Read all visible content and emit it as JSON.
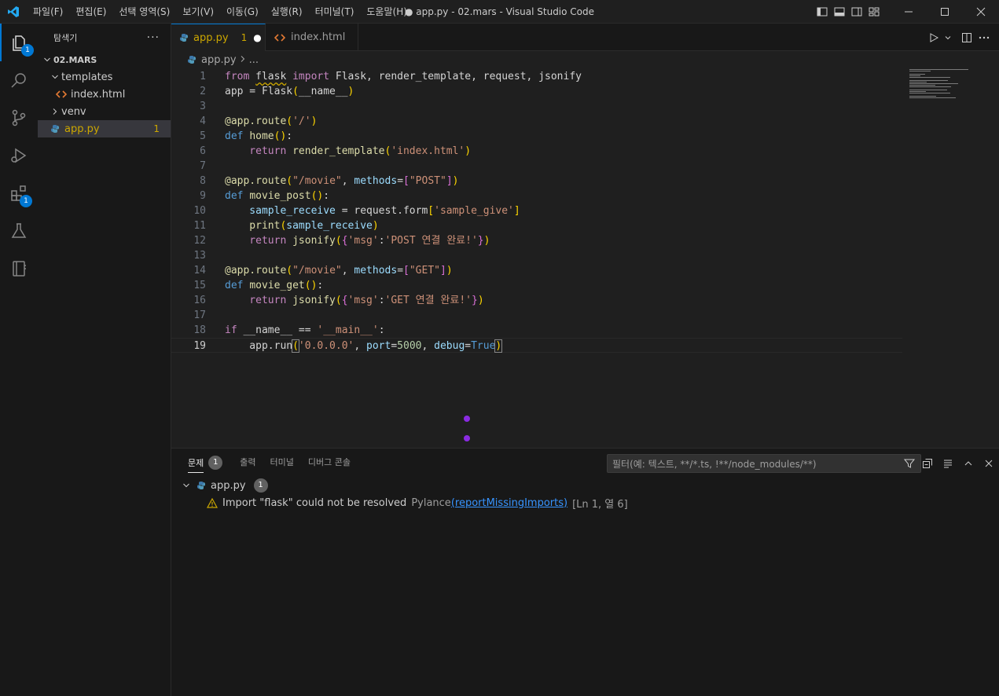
{
  "window": {
    "title": "● app.py - 02.mars - Visual Studio Code",
    "menu": [
      "파일(F)",
      "편집(E)",
      "선택 영역(S)",
      "보기(V)",
      "이동(G)",
      "실행(R)",
      "터미널(T)",
      "도움말(H)"
    ]
  },
  "activity_bar": {
    "explorer_badge": "1",
    "extensions_badge": "1"
  },
  "sidebar": {
    "title": "탐색기",
    "more": "···",
    "root": "02.MARS",
    "items": [
      {
        "label": "templates",
        "kind": "folder-open"
      },
      {
        "label": "index.html",
        "kind": "html-file"
      },
      {
        "label": "venv",
        "kind": "folder-closed"
      },
      {
        "label": "app.py",
        "kind": "python-file",
        "count": "1"
      }
    ]
  },
  "tabs": [
    {
      "label": "app.py",
      "count": "1",
      "modified": "●"
    },
    {
      "label": "index.html"
    }
  ],
  "breadcrumb": {
    "file": "app.py",
    "rest": "..."
  },
  "editor": {
    "lines": [
      {
        "n": "1",
        "tokens": [
          [
            "kw2",
            "from "
          ],
          [
            "tx sq",
            "flask"
          ],
          [
            "kw2",
            " import "
          ],
          [
            "tx",
            "Flask, render_template, request, jsonify"
          ]
        ]
      },
      {
        "n": "2",
        "tokens": [
          [
            "tx",
            "app = Flask"
          ],
          [
            "b1",
            "("
          ],
          [
            "tx",
            "__name__"
          ],
          [
            "b1",
            ")"
          ]
        ]
      },
      {
        "n": "3",
        "tokens": []
      },
      {
        "n": "4",
        "tokens": [
          [
            "fn",
            "@app.route"
          ],
          [
            "b1",
            "("
          ],
          [
            "st",
            "'/'"
          ],
          [
            "b1",
            ")"
          ]
        ]
      },
      {
        "n": "5",
        "tokens": [
          [
            "kw",
            "def "
          ],
          [
            "fn",
            "home"
          ],
          [
            "b1",
            "()"
          ],
          [
            "tx",
            ":"
          ]
        ]
      },
      {
        "n": "6",
        "tokens": [
          [
            "kw2",
            "    return "
          ],
          [
            "fn",
            "render_template"
          ],
          [
            "b1",
            "("
          ],
          [
            "st",
            "'index.html'"
          ],
          [
            "b1",
            ")"
          ]
        ]
      },
      {
        "n": "7",
        "tokens": []
      },
      {
        "n": "8",
        "tokens": [
          [
            "fn",
            "@app.route"
          ],
          [
            "b1",
            "("
          ],
          [
            "st",
            "\"/movie\""
          ],
          [
            "tx",
            ", "
          ],
          [
            "pm",
            "methods"
          ],
          [
            "tx",
            "="
          ],
          [
            "b2",
            "["
          ],
          [
            "st",
            "\"POST\""
          ],
          [
            "b2",
            "]"
          ],
          [
            "b1",
            ")"
          ]
        ]
      },
      {
        "n": "9",
        "tokens": [
          [
            "kw",
            "def "
          ],
          [
            "fn",
            "movie_post"
          ],
          [
            "b1",
            "()"
          ],
          [
            "tx",
            ":"
          ]
        ]
      },
      {
        "n": "10",
        "tokens": [
          [
            "pm",
            "    sample_receive"
          ],
          [
            "tx",
            " = request.form"
          ],
          [
            "b1",
            "["
          ],
          [
            "st",
            "'sample_give'"
          ],
          [
            "b1",
            "]"
          ]
        ]
      },
      {
        "n": "11",
        "tokens": [
          [
            "fn",
            "    print"
          ],
          [
            "b1",
            "("
          ],
          [
            "pm",
            "sample_receive"
          ],
          [
            "b1",
            ")"
          ]
        ]
      },
      {
        "n": "12",
        "tokens": [
          [
            "kw2",
            "    return "
          ],
          [
            "fn",
            "jsonify"
          ],
          [
            "b1",
            "("
          ],
          [
            "b2",
            "{"
          ],
          [
            "st",
            "'msg'"
          ],
          [
            "tx",
            ":"
          ],
          [
            "st",
            "'POST 연결 완료!'"
          ],
          [
            "b2",
            "}"
          ],
          [
            "b1",
            ")"
          ]
        ]
      },
      {
        "n": "13",
        "tokens": []
      },
      {
        "n": "14",
        "tokens": [
          [
            "fn",
            "@app.route"
          ],
          [
            "b1",
            "("
          ],
          [
            "st",
            "\"/movie\""
          ],
          [
            "tx",
            ", "
          ],
          [
            "pm",
            "methods"
          ],
          [
            "tx",
            "="
          ],
          [
            "b2",
            "["
          ],
          [
            "st",
            "\"GET\""
          ],
          [
            "b2",
            "]"
          ],
          [
            "b1",
            ")"
          ]
        ]
      },
      {
        "n": "15",
        "tokens": [
          [
            "kw",
            "def "
          ],
          [
            "fn",
            "movie_get"
          ],
          [
            "b1",
            "()"
          ],
          [
            "tx",
            ":"
          ]
        ]
      },
      {
        "n": "16",
        "tokens": [
          [
            "kw2",
            "    return "
          ],
          [
            "fn",
            "jsonify"
          ],
          [
            "b1",
            "("
          ],
          [
            "b2",
            "{"
          ],
          [
            "st",
            "'msg'"
          ],
          [
            "tx",
            ":"
          ],
          [
            "st",
            "'GET 연결 완료!'"
          ],
          [
            "b2",
            "}"
          ],
          [
            "b1",
            ")"
          ]
        ]
      },
      {
        "n": "17",
        "tokens": []
      },
      {
        "n": "18",
        "tokens": [
          [
            "kw2",
            "if "
          ],
          [
            "tx",
            "__name__ == "
          ],
          [
            "st",
            "'__main__'"
          ],
          [
            "tx",
            ":"
          ]
        ]
      },
      {
        "n": "19",
        "tokens": [
          [
            "tx",
            "    app.run"
          ],
          [
            "b1 bm",
            "("
          ],
          [
            "st",
            "'0.0.0.0'"
          ],
          [
            "tx",
            ", "
          ],
          [
            "pm",
            "port"
          ],
          [
            "tx",
            "="
          ],
          [
            "nm",
            "5000"
          ],
          [
            "tx",
            ", "
          ],
          [
            "pm",
            "debug"
          ],
          [
            "tx",
            "="
          ],
          [
            "kw",
            "True"
          ],
          [
            "b1 bm",
            ")"
          ]
        ]
      }
    ],
    "current_line": "19"
  },
  "panel": {
    "tabs": [
      {
        "label": "문제",
        "badge": "1"
      },
      {
        "label": "출력"
      },
      {
        "label": "터미널"
      },
      {
        "label": "디버그 콘솔"
      }
    ],
    "filter_placeholder": "필터(예: 텍스트, **/*.ts, !**/node_modules/**)",
    "problem_file": {
      "name": "app.py",
      "count": "1"
    },
    "problem": {
      "message": "Import \"flask\" could not be resolved",
      "source": "Pylance",
      "code": "(reportMissingImports)",
      "position": "[Ln 1, 열 6]"
    }
  },
  "colors": {
    "accent": "#0078d4",
    "warning": "#cca700",
    "link": "#3794ff"
  }
}
